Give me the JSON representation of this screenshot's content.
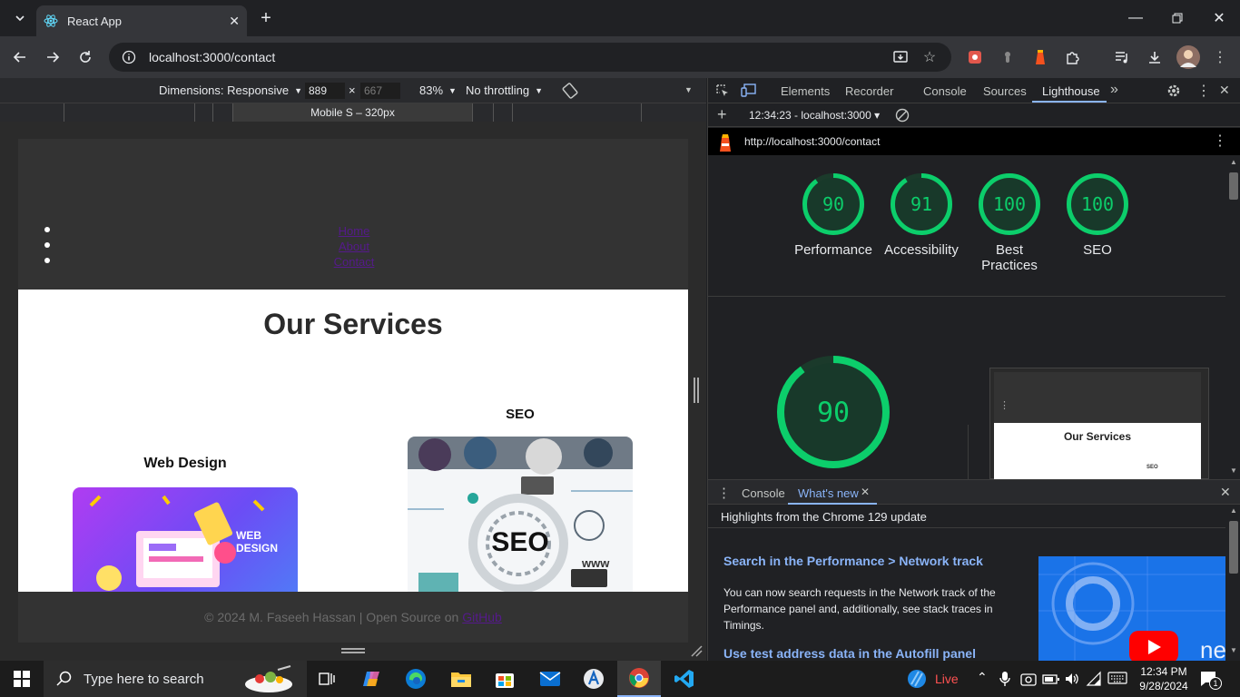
{
  "browser": {
    "tab_title": "React App",
    "url": "localhost:3000/contact",
    "new_tab": "+"
  },
  "device_toolbar": {
    "dimensions_label": "Dimensions: Responsive",
    "width": "889",
    "height": "667",
    "times": "×",
    "zoom": "83%",
    "throttling": "No throttling",
    "media_query_label": "Mobile S – 320px"
  },
  "page": {
    "nav_items": [
      "Home",
      "About",
      "Contact"
    ],
    "heading": "Our Services",
    "services": [
      {
        "title": "Web Design",
        "image_text": "WEB DESIGN"
      },
      {
        "title": "SEO",
        "image_text": "SEO"
      }
    ],
    "seo_www": "www",
    "footer_text": "© 2024 M. Faseeh Hassan | Open Source on ",
    "footer_link": "GitHub"
  },
  "devtools": {
    "tabs": [
      "Elements",
      "Recorder",
      "Console",
      "Sources",
      "Lighthouse"
    ],
    "active_tab": "Lighthouse",
    "report_selector": "12:34:23 - localhost:3000 ▾",
    "report_url": "http://localhost:3000/contact",
    "scores": [
      {
        "value": "90",
        "label": "Performance",
        "score": 90
      },
      {
        "value": "91",
        "label": "Accessibility",
        "score": 91
      },
      {
        "value": "100",
        "label": "Best Practices",
        "score": 100
      },
      {
        "value": "100",
        "label": "SEO",
        "score": 100
      }
    ],
    "big_score": {
      "value": "90",
      "score": 90
    },
    "thumbnail_heading": "Our Services",
    "thumbnail_seo": "SEO",
    "drawer_tabs": [
      "Console",
      "What's new"
    ],
    "drawer_active": "What's new",
    "whats_new_header": "Highlights from the Chrome 129 update",
    "article1_title": "Search in the Performance > Network track",
    "article1_body": "You can now search requests in the Network track of the Performance panel and, additionally, see stack traces in Timings.",
    "article2_title": "Use test address data in the Autofill panel",
    "video_text": "ne"
  },
  "taskbar": {
    "search_placeholder": "Type here to search",
    "live_label": "Live",
    "time": "12:34 PM",
    "date": "9/28/2024",
    "notification_count": "1"
  },
  "colors": {
    "score_green": "#0cce6b",
    "link_blue": "#8ab4f8",
    "nav_link": "#551a8b"
  }
}
